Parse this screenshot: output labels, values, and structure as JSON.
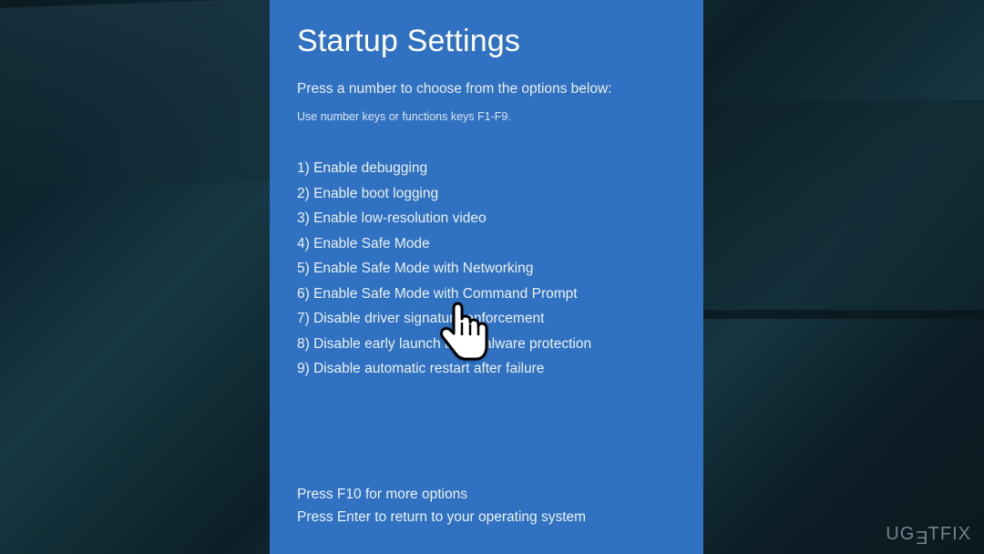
{
  "panel": {
    "title": "Startup Settings",
    "subtitle": "Press a number to choose from the options below:",
    "hint": "Use number keys or functions keys F1-F9.",
    "options": [
      "1) Enable debugging",
      "2) Enable boot logging",
      "3) Enable low-resolution video",
      "4) Enable Safe Mode",
      "5) Enable Safe Mode with Networking",
      "6) Enable Safe Mode with Command Prompt",
      "7) Disable driver signature enforcement",
      "8) Disable early launch anti-malware protection",
      "9) Disable automatic restart after failure"
    ],
    "footer_more": "Press F10 for more options",
    "footer_return": "Press Enter to return to your operating system"
  },
  "watermark": {
    "u": "U",
    "g": "G",
    "e": "E",
    "t": "T",
    "f": "F",
    "i": "I",
    "x": "X"
  }
}
